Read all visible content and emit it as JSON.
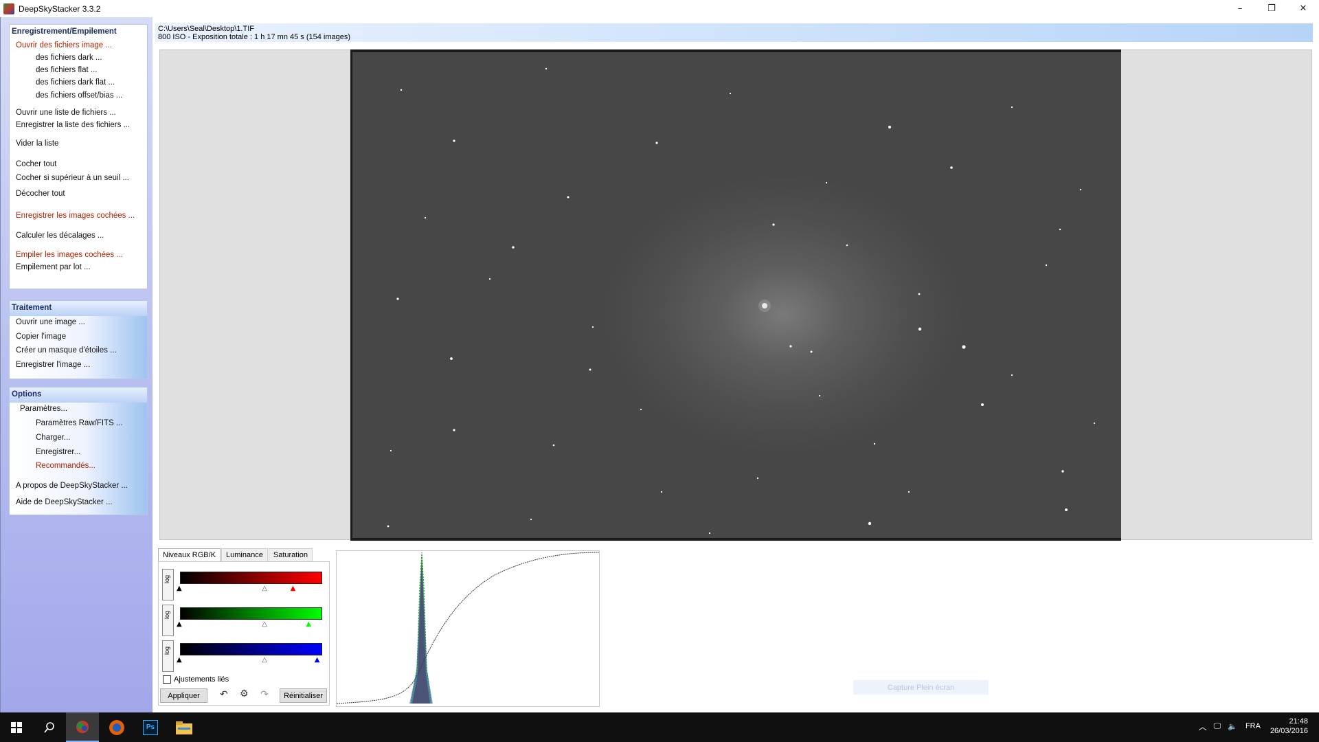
{
  "window": {
    "title": "DeepSkyStacker 3.3.2",
    "minimize": "–",
    "maximize": "❐",
    "close": "✕"
  },
  "sidebar": {
    "register": {
      "title": "Enregistrement/Empilement",
      "items": [
        {
          "label": "Ouvrir des fichiers image ...",
          "red": true
        },
        {
          "label": "des fichiers dark ..."
        },
        {
          "label": "des fichiers flat ..."
        },
        {
          "label": "des fichiers dark flat ..."
        },
        {
          "label": "des fichiers offset/bias ..."
        },
        {
          "label": "Ouvrir une liste de fichiers ..."
        },
        {
          "label": "Enregistrer la liste des fichiers ..."
        },
        {
          "label": "Vider la liste"
        },
        {
          "label": "Cocher tout"
        },
        {
          "label": "Cocher si supérieur à un seuil ..."
        },
        {
          "label": "Décocher tout"
        },
        {
          "label": "Enregistrer les images cochées ...",
          "red": true
        },
        {
          "label": "Calculer les décalages ..."
        },
        {
          "label": "Empiler les images cochées ...",
          "red": true
        },
        {
          "label": "Empilement par lot ..."
        }
      ]
    },
    "processing": {
      "title": "Traitement",
      "items": [
        {
          "label": "Ouvrir une image ..."
        },
        {
          "label": "Copier l'image"
        },
        {
          "label": "Créer un masque d'étoiles ..."
        },
        {
          "label": "Enregistrer l'image ..."
        }
      ]
    },
    "options": {
      "title": "Options",
      "items": [
        {
          "label": "Paramètres..."
        },
        {
          "label": "Paramètres Raw/FITS ..."
        },
        {
          "label": "Charger..."
        },
        {
          "label": "Enregistrer..."
        },
        {
          "label": "Recommandés...",
          "red": true
        },
        {
          "label": "A propos de DeepSkyStacker ..."
        },
        {
          "label": "Aide de DeepSkyStacker ..."
        }
      ]
    }
  },
  "image_info": {
    "path": "C:\\Users\\Seal\\Desktop\\1.TIF",
    "details": "800 ISO - Exposition totale : 1 h 17 mn 45 s (154 images)"
  },
  "levels": {
    "tabs": [
      "Niveaux RGB/K",
      "Luminance",
      "Saturation"
    ],
    "log_label": "log",
    "linked_label": "Ajustements liés",
    "apply_label": "Appliquer",
    "reset_label": "Réinitialiser",
    "channels": [
      {
        "name": "red",
        "color": "#ff0000",
        "black": 0.0,
        "mid": 0.6,
        "white": 0.8
      },
      {
        "name": "green",
        "color": "#00ff00",
        "black": 0.0,
        "mid": 0.6,
        "white": 0.91
      },
      {
        "name": "blue",
        "color": "#0000ff",
        "black": 0.0,
        "mid": 0.6,
        "white": 0.97
      }
    ]
  },
  "capture_label": "Capture Plein écran",
  "taskbar": {
    "language": "FRA",
    "time": "21:48",
    "date": "26/03/2016",
    "ps_label": "Ps"
  },
  "colors": {
    "accent": "#1a2e6a",
    "red_text": "#b22200",
    "sidebar_bg": "#a8b0ee"
  }
}
